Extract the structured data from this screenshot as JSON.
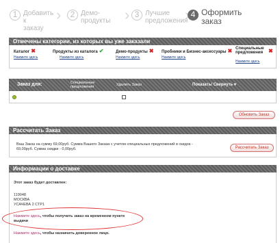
{
  "steps": [
    {
      "num": "1",
      "label_line1": "Добавить к",
      "label_line2": "заказу"
    },
    {
      "num": "2",
      "label_line1": "Демо-продукты",
      "label_line2": ""
    },
    {
      "num": "3",
      "label_line1": "Лучшие",
      "label_line2": "предложения"
    },
    {
      "num": "4",
      "label_line1": "Оформить",
      "label_line2": "заказ"
    }
  ],
  "categories_header": "Отмечены категории, из которых вы уже заказали",
  "categories": [
    {
      "name": "Каталог",
      "status": "✖",
      "link": "Нажмите здесь"
    },
    {
      "name": "Продукты из каталога",
      "status": "✔",
      "link": "Нажмите здесь"
    },
    {
      "name": "Демо-продукты",
      "status": "✖",
      "link": "Нажмите здесь"
    },
    {
      "name": "Пробники и Бизнес-аксессуары",
      "status": "✖",
      "link": "Нажмите здесь"
    },
    {
      "name_line1": "Специальные",
      "name_line2": "предложения",
      "status": "✖",
      "link": "Нажмите здесь"
    }
  ],
  "order": {
    "col_order_for": "Заказ для:",
    "col_special_line1": "Специальные",
    "col_special_line2": "предложения",
    "col_delete": "Удалить Заказ",
    "col_show": "Показать/ Свернуть",
    "update_button": "Обновить Заказ"
  },
  "calc": {
    "header": "Рассчитать Заказ",
    "text_line1": "Ваш Заказ на сумму 69,00руб. Сумма Вашего Заказа с учетом специальных предложений и скидок -",
    "text_line2": "69,00руб. Сумма скидки - 0,00руб.",
    "button": "Рассчитать Заказ"
  },
  "delivery": {
    "header": "Информации о доставке",
    "title": "Этот заказ будет доставлен:",
    "address_line1": "119048",
    "address_line2": "МОСКВА",
    "address_line3": "УСАЧЕВА 2 СТР1",
    "pickup_link": "Нажмите здесь",
    "pickup_text_line1": ", чтобы получить заказ на временном пункте",
    "pickup_text_line2": "выдачи",
    "trusted_link": "Нажмите здесь",
    "trusted_text": ", чтобы назначить доверенное лицо."
  }
}
